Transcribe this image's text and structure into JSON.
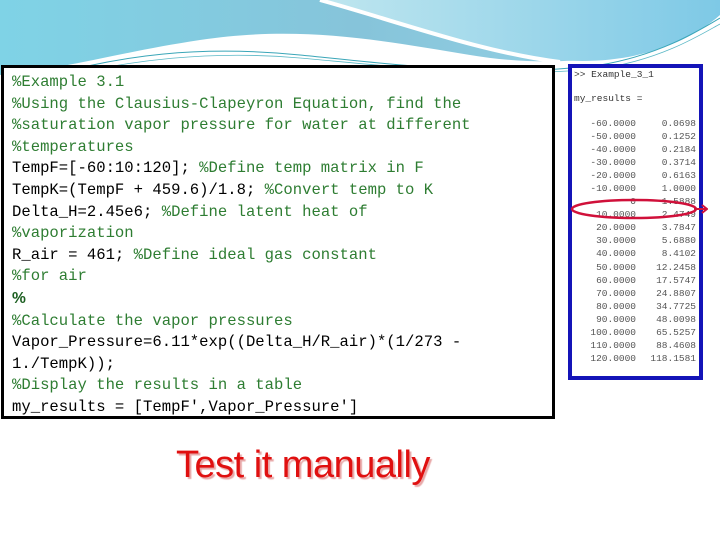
{
  "slide": {
    "code_lines": [
      {
        "code": "",
        "comment": "%Example 3.1"
      },
      {
        "code": "",
        "comment": "%Using the Clausius-Clapeyron Equation, find the"
      },
      {
        "code": "",
        "comment": "%saturation vapor pressure for water at different"
      },
      {
        "code": "",
        "comment": "%temperatures"
      },
      {
        "code": "TempF=[-60:10:120]; ",
        "comment": "%Define temp matrix in F"
      },
      {
        "code": "TempK=(TempF + 459.6)/1.8; ",
        "comment": "%Convert temp to K"
      },
      {
        "code": "Delta_H=2.45e6; ",
        "comment": "%Define latent heat of"
      },
      {
        "code": "",
        "comment": "%vaporization"
      },
      {
        "code": "R_air = 461; ",
        "comment": "%Define ideal gas constant"
      },
      {
        "code": "",
        "comment": "%for air"
      },
      {
        "code": "",
        "comment": "",
        "bold_pct": "%"
      },
      {
        "code": "",
        "comment": "%Calculate the vapor pressures"
      },
      {
        "code": "Vapor_Pressure=6.11*exp((Delta_H/R_air)*(1/273 -",
        "comment": ""
      },
      {
        "code": "1./TempK));",
        "comment": ""
      },
      {
        "code": "",
        "comment": "%Display the results in a table"
      },
      {
        "code": "my_results = [TempF',Vapor_Pressure']",
        "comment": ""
      }
    ],
    "output": {
      "command": ">> Example_3_1",
      "var_label": "my_results =",
      "rows": [
        [
          "-60.0000",
          "0.0698"
        ],
        [
          "-50.0000",
          "0.1252"
        ],
        [
          "-40.0000",
          "0.2184"
        ],
        [
          "-30.0000",
          "0.3714"
        ],
        [
          "-20.0000",
          "0.6163"
        ],
        [
          "-10.0000",
          "1.0000"
        ],
        [
          "0",
          "1.5888"
        ],
        [
          "10.0000",
          "2.4749"
        ],
        [
          "20.0000",
          "3.7847"
        ],
        [
          "30.0000",
          "5.6880"
        ],
        [
          "40.0000",
          "8.4102"
        ],
        [
          "50.0000",
          "12.2458"
        ],
        [
          "60.0000",
          "17.5747"
        ],
        [
          "70.0000",
          "24.8807"
        ],
        [
          "80.0000",
          "34.7725"
        ],
        [
          "90.0000",
          "48.0098"
        ],
        [
          "100.0000",
          "65.5257"
        ],
        [
          "110.0000",
          "88.4608"
        ],
        [
          "120.0000",
          "118.1581"
        ]
      ],
      "highlighted_row": 6
    },
    "caption": "Test it manually",
    "colors": {
      "comment": "#2e7d32",
      "output_border": "#1414b8",
      "highlight": "#d0103a",
      "caption": "#e01010"
    }
  }
}
